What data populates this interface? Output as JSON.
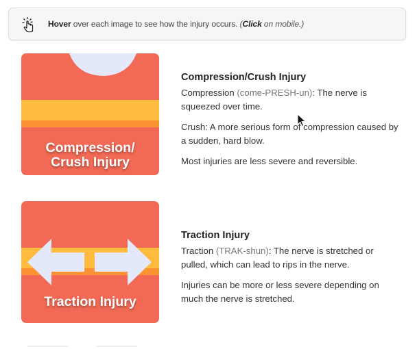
{
  "hint": {
    "icon": "pointer-tap-icon",
    "bold_word": "Hover",
    "text": " over each image to see how the injury occurs. ",
    "paren_open": "(",
    "click_word": "Click",
    "mobile_text": " on mobile.)"
  },
  "sections": [
    {
      "card_label_line1": "Compression/",
      "card_label_line2": "Crush Injury",
      "title": "Compression/Crush Injury",
      "term": "Compression",
      "pronunciation": "(come-PRESH-un)",
      "definition": ": The nerve is squeezed over time.",
      "para2": "Crush: A more serious form of compression caused by a sudden, hard blow.",
      "para3": "Most injuries are less severe and reversible."
    },
    {
      "card_label": "Traction Injury",
      "title": "Traction Injury",
      "term": "Traction",
      "pronunciation": "(TRAK-shun)",
      "definition": ": The nerve is stretched or pulled, which can lead to rips in the nerve.",
      "para2": "Injuries can be more or less severe depending on much the nerve is stretched."
    }
  ],
  "colors": {
    "card_red": "#f26a55",
    "band_yellow": "#ffbb3d",
    "band_orange": "#fb9332",
    "shape_lavender": "#e3e8fa"
  }
}
